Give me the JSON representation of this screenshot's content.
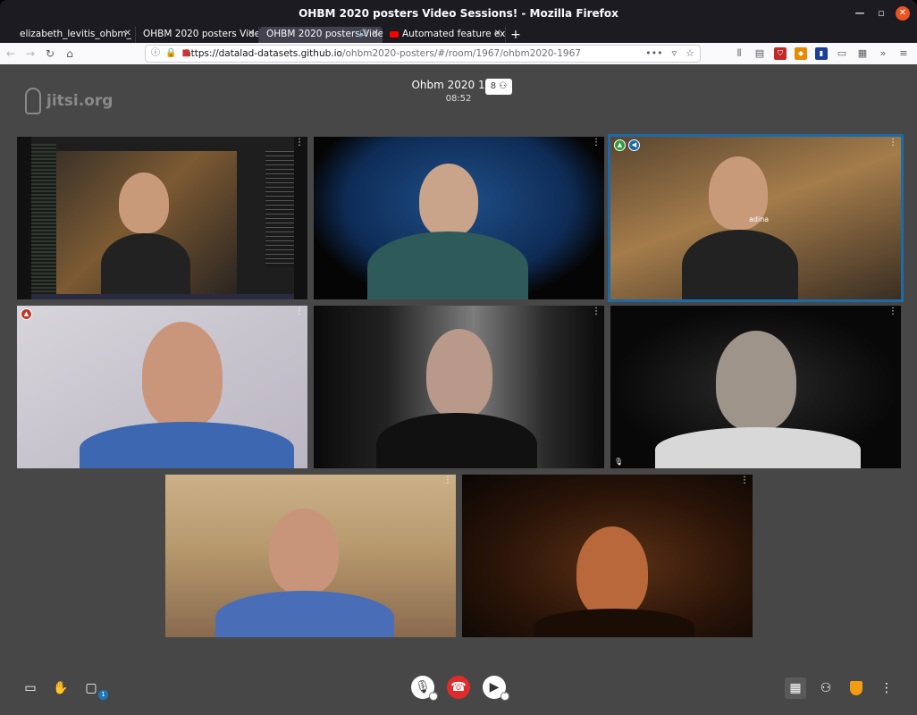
{
  "window": {
    "title": "OHBM 2020 posters Video Sessions! - Mozilla Firefox"
  },
  "tabs": [
    {
      "label": "elizabeth_levitis_ohbm_"
    },
    {
      "label": "OHBM 2020 posters Video S"
    },
    {
      "label": "OHBM 2020 posters Vide"
    },
    {
      "label": "Automated feature extra"
    }
  ],
  "url": {
    "host": "https://datalad-datasets.github.io",
    "path": "/ohbm2020-posters/#/room/1967/ohbm2020-1967"
  },
  "meeting": {
    "title": "Ohbm 2020 1967",
    "participants": "8",
    "timer": "08:52"
  },
  "logo": {
    "text": "jitsi.org"
  },
  "tiles": [
    {
      "name": ""
    },
    {
      "name": ""
    },
    {
      "name": "adina"
    },
    {
      "name": ""
    },
    {
      "name": ""
    },
    {
      "name": ""
    },
    {
      "name": ""
    },
    {
      "name": ""
    }
  ],
  "toolbar": {
    "chat_unread": "1"
  },
  "colors": {
    "stage": "#474747",
    "active_border": "#1d6aa8",
    "hangup": "#e02b2b",
    "firefox_dark": "#1c1b22"
  }
}
